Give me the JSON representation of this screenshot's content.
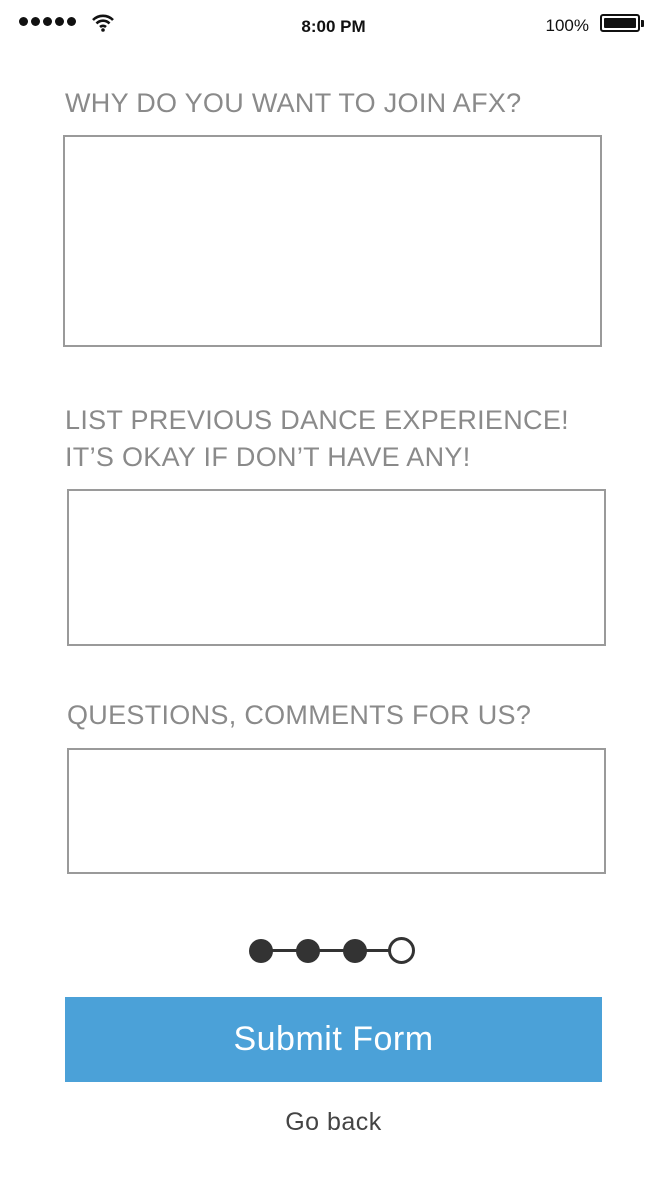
{
  "status_bar": {
    "time": "8:00 PM",
    "battery_percent": "100%",
    "signal_icon": "signal-dots-icon",
    "wifi_icon": "wifi-icon",
    "battery_icon": "battery-icon"
  },
  "form": {
    "q1": {
      "label": "WHY DO YOU WANT TO JOIN AFX?",
      "value": ""
    },
    "q2": {
      "label_line1": "LIST PREVIOUS DANCE EXPERIENCE!",
      "label_line2": "IT’S OKAY IF DON’T HAVE ANY!",
      "value": ""
    },
    "q3": {
      "label": "QUESTIONS, COMMENTS FOR US?",
      "value": ""
    }
  },
  "progress": {
    "current_step": 4,
    "total_steps": 4,
    "completed_steps": 3
  },
  "actions": {
    "submit_label": "Submit Form",
    "back_label": "Go back"
  },
  "colors": {
    "accent": "#4ba1d8",
    "label_gray": "#8a8a8a",
    "border_gray": "#9a9a9a",
    "step_dark": "#333333"
  }
}
